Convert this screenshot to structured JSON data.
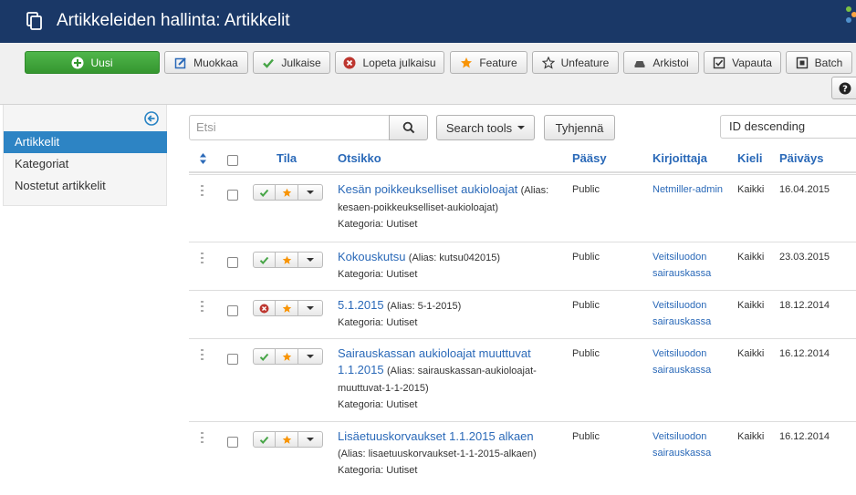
{
  "header": {
    "title": "Artikkeleiden hallinta: Artikkelit",
    "page_icon": "copy-icon",
    "logo": "joomla-logo"
  },
  "toolbar": {
    "new": "Uusi",
    "edit": "Muokkaa",
    "publish": "Julkaise",
    "unpublish": "Lopeta julkaisu",
    "feature": "Feature",
    "unfeature": "Unfeature",
    "archive": "Arkistoi",
    "checkin": "Vapauta",
    "batch": "Batch",
    "help": "?"
  },
  "sidebar": {
    "items": [
      {
        "label": "Artikkelit",
        "active": true
      },
      {
        "label": "Kategoriat",
        "active": false
      },
      {
        "label": "Nostetut artikkelit",
        "active": false
      }
    ]
  },
  "filters": {
    "search_placeholder": "Etsi",
    "search_tools": "Search tools",
    "clear": "Tyhjennä",
    "ordering": "ID descending"
  },
  "table": {
    "headers": {
      "status": "Tila",
      "title": "Otsikko",
      "access": "Pääsy",
      "author": "Kirjoittaja",
      "language": "Kieli",
      "date": "Päiväys"
    },
    "rows": [
      {
        "title": "Kesän poikkeukselliset aukioloajat",
        "alias": "(Alias: kesaen-poikkeukselliset-aukioloajat)",
        "category": "Kategoria: Uutiset",
        "published": true,
        "access": "Public",
        "author": "Netmiller-admin",
        "language": "Kaikki",
        "date": "16.04.2015"
      },
      {
        "title": "Kokouskutsu",
        "alias": "(Alias: kutsu042015)",
        "category": "Kategoria: Uutiset",
        "published": true,
        "access": "Public",
        "author": "Veitsiluodon sairauskassa",
        "language": "Kaikki",
        "date": "23.03.2015"
      },
      {
        "title": "5.1.2015",
        "alias": "(Alias: 5-1-2015)",
        "category": "Kategoria: Uutiset",
        "published": false,
        "access": "Public",
        "author": "Veitsiluodon sairauskassa",
        "language": "Kaikki",
        "date": "18.12.2014"
      },
      {
        "title": "Sairauskassan aukioloajat muuttuvat 1.1.2015",
        "alias": "(Alias: sairauskassan-aukioloajat-muuttuvat-1-1-2015)",
        "category": "Kategoria: Uutiset",
        "published": true,
        "access": "Public",
        "author": "Veitsiluodon sairauskassa",
        "language": "Kaikki",
        "date": "16.12.2014"
      },
      {
        "title": "Lisäetuuskorvaukset 1.1.2015 alkaen",
        "alias": "(Alias: lisaetuuskorvaukset-1-1-2015-alkaen)",
        "category": "Kategoria: Uutiset",
        "published": true,
        "access": "Public",
        "author": "Veitsiluodon sairauskassa",
        "language": "Kaikki",
        "date": "16.12.2014"
      }
    ]
  },
  "colors": {
    "header_bg": "#1a3867",
    "link": "#2a69b8",
    "active_nav": "#2d84c4",
    "success": "#46a546",
    "danger": "#bd362f",
    "star": "#f89406"
  }
}
